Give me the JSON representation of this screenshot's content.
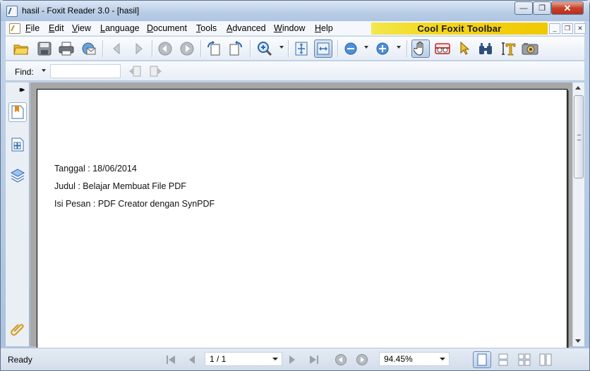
{
  "window": {
    "title": "hasil - Foxit Reader 3.0 - [hasil]",
    "close_glyph": "✕",
    "min_glyph": "—",
    "max_glyph": "❐"
  },
  "menu": {
    "items": [
      {
        "label": "File",
        "u": "F"
      },
      {
        "label": "Edit",
        "u": "E"
      },
      {
        "label": "View",
        "u": "V"
      },
      {
        "label": "Language",
        "u": "L"
      },
      {
        "label": "Document",
        "u": "D"
      },
      {
        "label": "Tools",
        "u": "T"
      },
      {
        "label": "Advanced",
        "u": "A"
      },
      {
        "label": "Window",
        "u": "W"
      },
      {
        "label": "Help",
        "u": "H"
      }
    ],
    "cool_toolbar": "Cool Foxit Toolbar"
  },
  "find": {
    "label": "Find:",
    "value": ""
  },
  "document": {
    "lines": [
      "Tanggal : 18/06/2014",
      "Judul : Belajar Membuat File PDF",
      "Isi Pesan : PDF Creator dengan SynPDF"
    ]
  },
  "status": {
    "text": "Ready",
    "page": "1 / 1",
    "zoom": "94.45%"
  },
  "colors": {
    "accent": "#2a64b0",
    "banner": "#f5d51a",
    "doc_bg": "#a7a7a7"
  }
}
